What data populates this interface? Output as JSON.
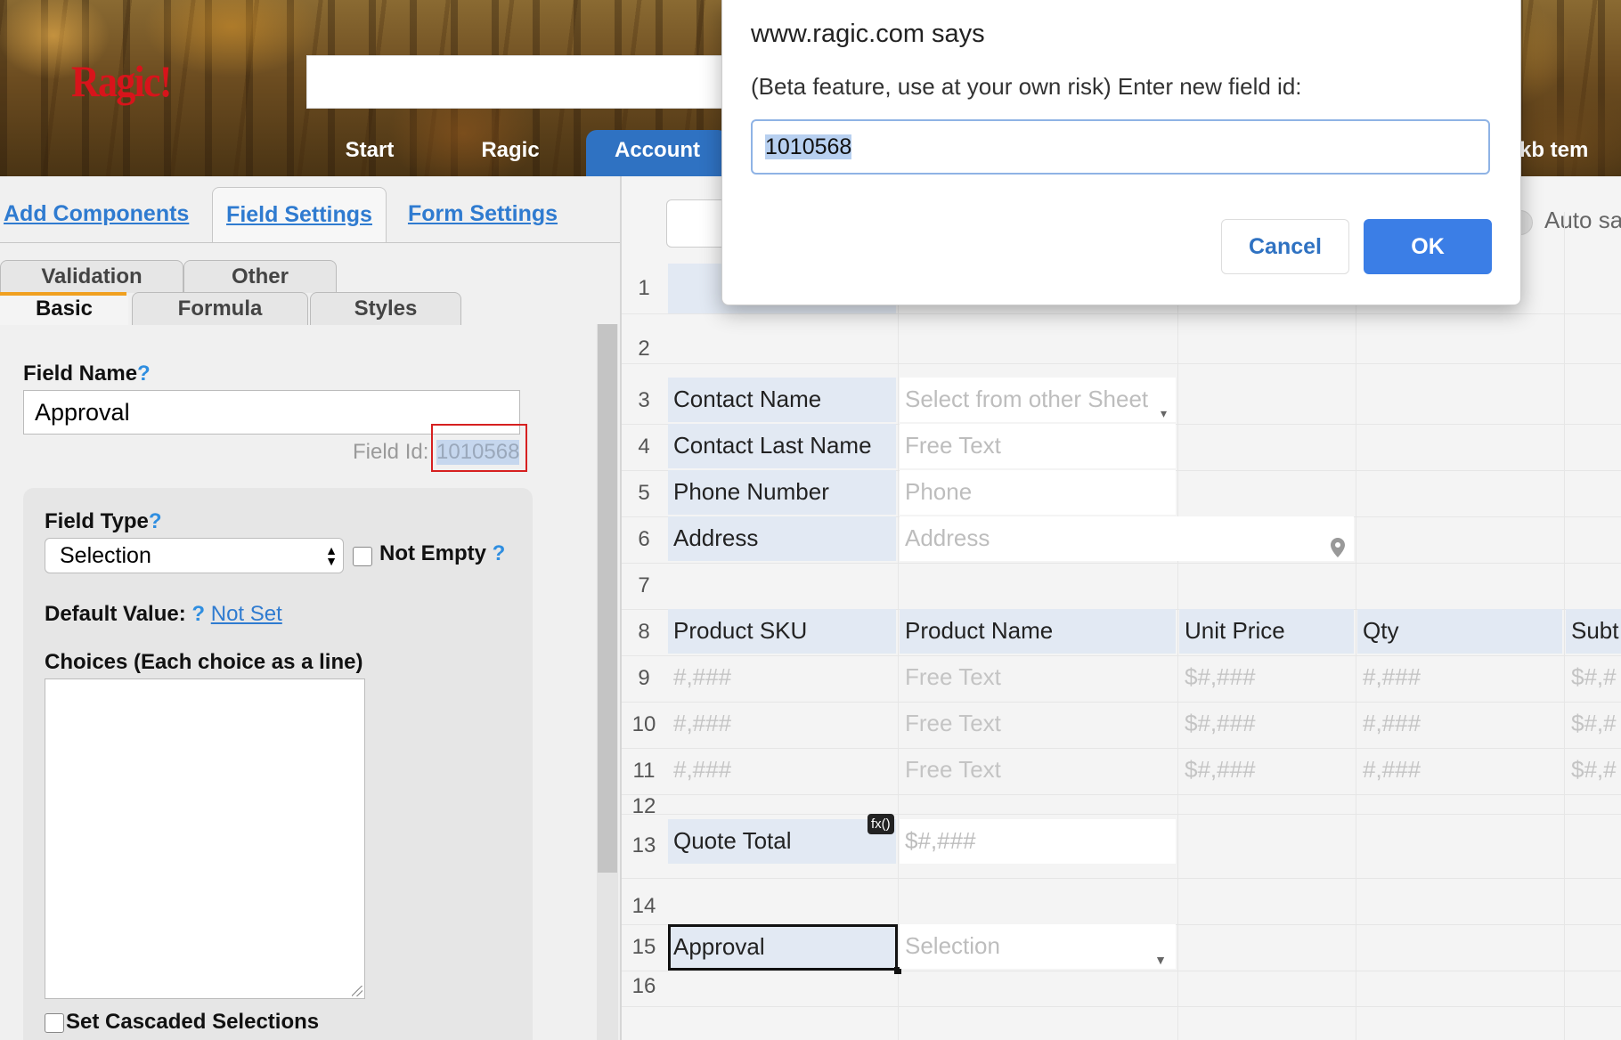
{
  "header": {
    "logo": "Ragic!",
    "nav_tabs": [
      "Start",
      "Ragic",
      "Account",
      "kb tem"
    ]
  },
  "left_panel": {
    "top_tabs": [
      "Add Components",
      "Field Settings",
      "Form Settings"
    ],
    "sub_tabs_row1": [
      "Validation",
      "Other"
    ],
    "sub_tabs_row2": [
      "Basic",
      "Formula",
      "Styles"
    ],
    "field_name_label": "Field Name",
    "help_mark": "?",
    "field_name_value": "Approval",
    "field_id_label": "Field Id:",
    "field_id_value": "1010568",
    "field_type_label": "Field Type",
    "field_type_value": "Selection",
    "not_empty_label": "Not Empty",
    "default_value_label": "Default Value:",
    "default_value_link": "Not Set",
    "choices_label": "Choices (Each choice as a line)",
    "cascaded_label": "Set Cascaded Selections"
  },
  "sheet": {
    "autosave_label": "Auto sa",
    "row_numbers": [
      "1",
      "2",
      "3",
      "4",
      "5",
      "6",
      "7",
      "8",
      "9",
      "10",
      "11",
      "12",
      "13",
      "14",
      "15",
      "16"
    ],
    "contact_name": "Contact Name",
    "contact_name_ph": "Select from other Sheet",
    "contact_last_name": "Contact Last Name",
    "contact_last_name_ph": "Free Text",
    "phone_number": "Phone Number",
    "phone_ph": "Phone",
    "address": "Address",
    "address_ph": "Address",
    "product_headers": [
      "Product SKU",
      "Product Name",
      "Unit Price",
      "Qty",
      "Subt"
    ],
    "product_rows": [
      [
        "#,###",
        "Free Text",
        "$#,###",
        "#,###",
        "$#,#"
      ],
      [
        "#,###",
        "Free Text",
        "$#,###",
        "#,###",
        "$#,#"
      ],
      [
        "#,###",
        "Free Text",
        "$#,###",
        "#,###",
        "$#,#"
      ]
    ],
    "quote_total": "Quote Total",
    "fx_badge": "fx()",
    "quote_total_ph": "$#,###",
    "approval": "Approval",
    "approval_ph": "Selection"
  },
  "dialog": {
    "title": "www.ragic.com says",
    "message": "(Beta feature, use at your own risk) Enter new field id:",
    "input_value": "1010568",
    "cancel_label": "Cancel",
    "ok_label": "OK"
  },
  "colors": {
    "accent_blue": "#2f72c2",
    "ok_button": "#3b7ee6",
    "highlight_red": "#d62020",
    "label_cell_bg": "#e2e9f3"
  }
}
